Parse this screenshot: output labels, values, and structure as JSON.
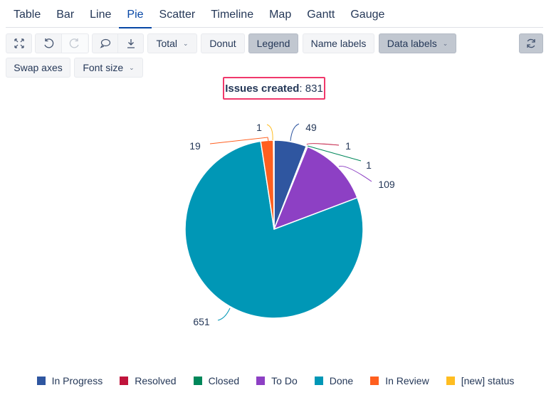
{
  "tabs": [
    "Table",
    "Bar",
    "Line",
    "Pie",
    "Scatter",
    "Timeline",
    "Map",
    "Gantt",
    "Gauge"
  ],
  "active_tab": "Pie",
  "toolbar": {
    "total_label": "Total",
    "donut_label": "Donut",
    "legend_label": "Legend",
    "name_labels_label": "Name labels",
    "data_labels_label": "Data labels",
    "swap_axes_label": "Swap axes",
    "font_size_label": "Font size"
  },
  "chart_data": {
    "type": "pie",
    "title": "Issues created",
    "total": "831",
    "categories": [
      "In Progress",
      "Resolved",
      "Closed",
      "To Do",
      "Done",
      "In Review",
      "[new] status"
    ],
    "values": [
      49,
      1,
      1,
      109,
      651,
      19,
      1
    ],
    "colors": [
      "#2f56a0",
      "#c0143c",
      "#00875a",
      "#8d40c4",
      "#0097b6",
      "#ff5f1f",
      "#ffbd21"
    ],
    "legend_position": "bottom",
    "data_labels": true
  }
}
